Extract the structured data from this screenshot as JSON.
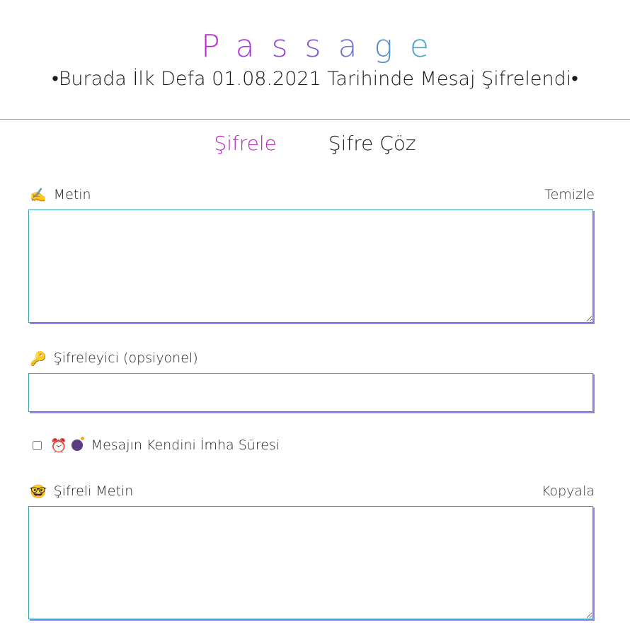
{
  "header": {
    "logo": "Passage",
    "tagline": "•Burada İlk Defa 01.08.2021 Tarihinde Mesaj Şifrelendi•"
  },
  "tabs": [
    {
      "label": "Şifrele",
      "active": true
    },
    {
      "label": "Şifre Çöz",
      "active": false
    }
  ],
  "fields": {
    "text": {
      "emoji": "✍️",
      "label": "Metin",
      "action": "Temizle",
      "value": ""
    },
    "key": {
      "emoji": "🔑",
      "label": "Şifreleyici (opsiyonel)",
      "value": ""
    },
    "self_destruct": {
      "label": "Mesajın Kendini İmha Süresi",
      "checked": false,
      "icons": [
        "alarm-clock-icon",
        "bomb-icon"
      ]
    },
    "cipher": {
      "emoji": "🤓",
      "label": "Şifreli Metin",
      "action": "Kopyala",
      "value": ""
    }
  },
  "colors": {
    "accent": "#c026c7",
    "border": "#36a2b0",
    "shadow": "#8d86f7"
  }
}
